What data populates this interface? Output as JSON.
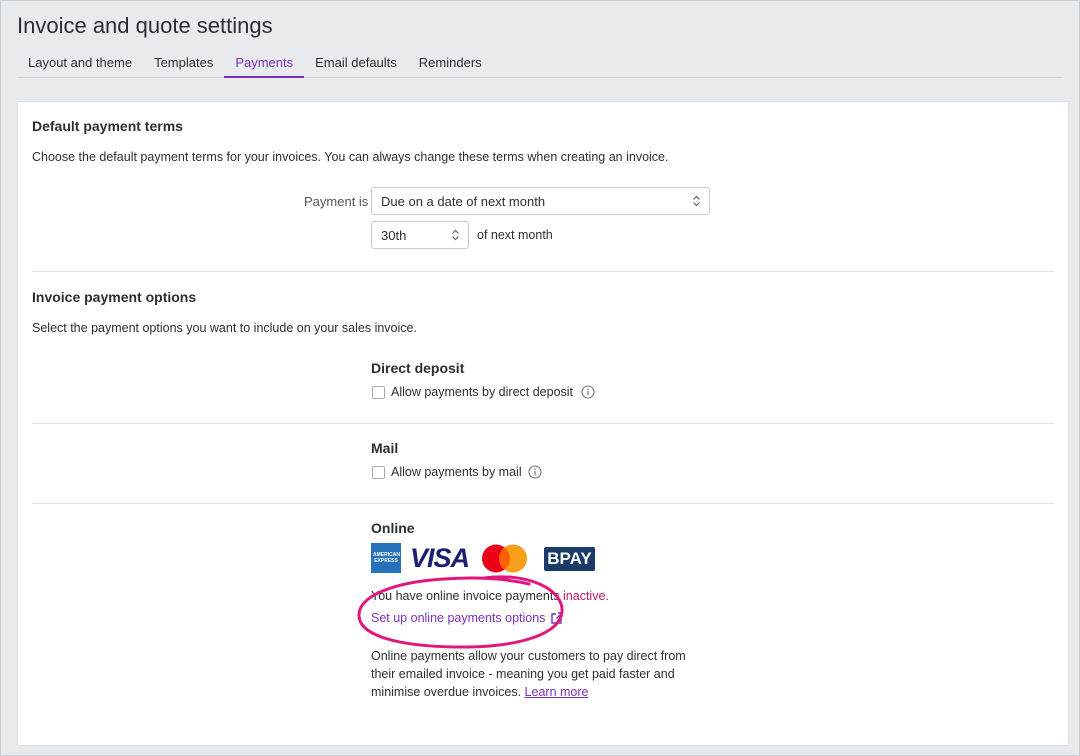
{
  "page": {
    "title": "Invoice and quote settings"
  },
  "tabs": [
    {
      "label": "Layout and theme"
    },
    {
      "label": "Templates"
    },
    {
      "label": "Payments"
    },
    {
      "label": "Email defaults"
    },
    {
      "label": "Reminders"
    }
  ],
  "active_tab": "Payments",
  "payment_terms": {
    "title": "Default payment terms",
    "description": "Choose the default payment terms for your invoices. You can always change these terms when creating an invoice.",
    "payment_is_label": "Payment is",
    "payment_is_value": "Due on a date of next month",
    "day_value": "30th",
    "day_suffix": "of next month"
  },
  "payment_options": {
    "title": "Invoice payment options",
    "description": "Select the payment options you want to include on your sales invoice.",
    "direct_deposit": {
      "heading": "Direct deposit",
      "checkbox_label": "Allow payments by direct deposit",
      "checked": false
    },
    "mail": {
      "heading": "Mail",
      "checkbox_label": "Allow payments by mail",
      "checked": false
    },
    "online": {
      "heading": "Online",
      "logos": [
        "amex-logo",
        "visa-logo",
        "mastercard-logo",
        "bpay-logo"
      ],
      "status_prefix": "You have online invoice payments ",
      "status_value": "inactive.",
      "setup_link": "Set up online payments options",
      "info_text": "Online payments allow your customers to pay direct from their emailed invoice - meaning you get paid faster and minimise overdue invoices.",
      "learn_more": "Learn more",
      "amex_text": "AMERICAN EXPRESS",
      "visa_text": "VISA",
      "bpay_text": "BPAY"
    }
  },
  "colors": {
    "accent": "#7a30b8",
    "highlight_circle": "#e0177d",
    "inactive": "#c2185b"
  }
}
